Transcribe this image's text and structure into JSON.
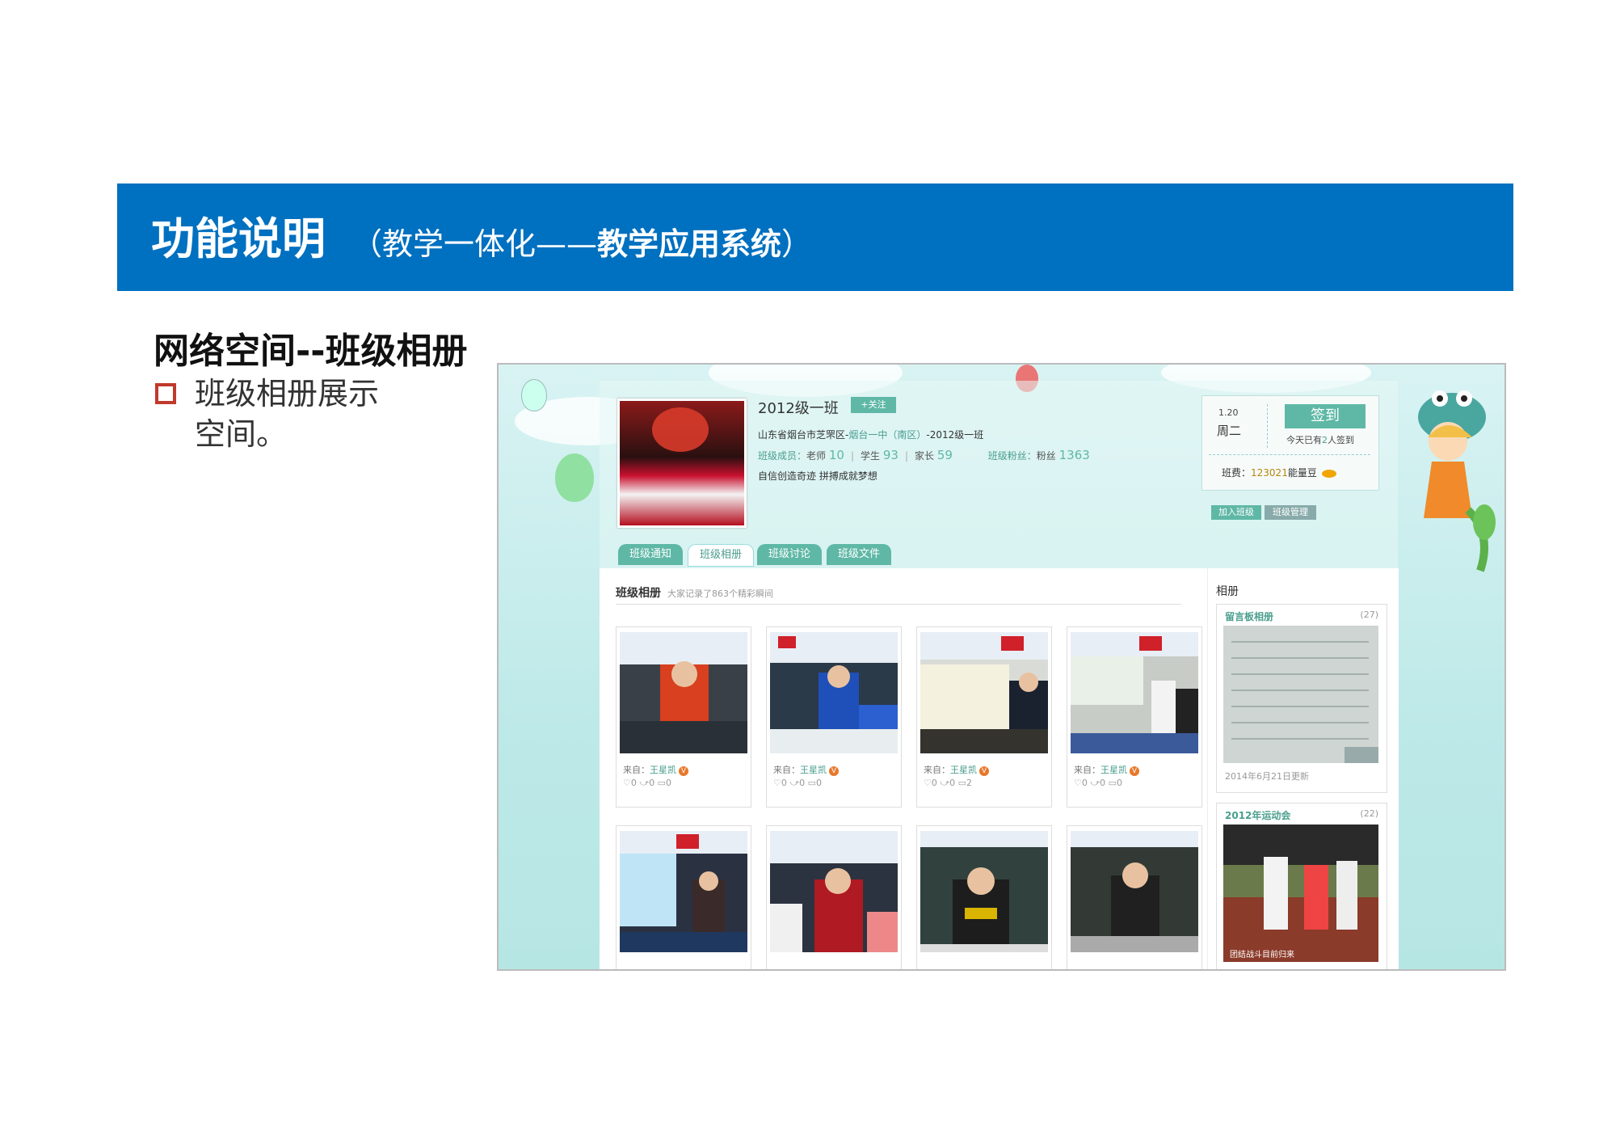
{
  "slide": {
    "header_title": "功能说明",
    "header_sub_open": "（教学一体化——",
    "header_sub_bold": "教学应用系统",
    "header_sub_close": "）",
    "section_title": "网络空间--班级相册",
    "bullet_line1": "班级相册展示",
    "bullet_line2": "空间。"
  },
  "class_page": {
    "class_name": "2012级一班",
    "follow_label": "+关注",
    "address_prefix": "山东省烟台市芝罘区-",
    "address_link": "烟台一中（南区）",
    "address_suffix": "-2012级一班",
    "members_label": "班级成员：",
    "teacher_label": "老师",
    "teacher_count": "10",
    "student_label": "学生",
    "student_count": "93",
    "parent_label": "家长",
    "parent_count": "59",
    "fans_label": "班级粉丝：",
    "fans_prefix": "粉丝",
    "fans_count": "1363",
    "motto": "自信创造奇迹   拼搏成就梦想",
    "sign": {
      "date": "1.20",
      "weekday": "周二",
      "button": "签到",
      "note_pre": "今天已有",
      "note_num": "2",
      "note_post": "人签到",
      "bean_label": "班费：",
      "bean_num": "123021",
      "bean_unit": "能量豆"
    },
    "join_button": "加入班级",
    "manage_button": "班级管理",
    "tabs": [
      "班级通知",
      "班级相册",
      "班级讨论",
      "班级文件"
    ],
    "album_header": "班级相册",
    "album_subheader": "大家记录了863个精彩瞬间",
    "photos": [
      {
        "from": "来自：",
        "user": "王星凯",
        "likes": "0",
        "shares": "0",
        "comments": "0"
      },
      {
        "from": "来自：",
        "user": "王星凯",
        "likes": "0",
        "shares": "0",
        "comments": "0"
      },
      {
        "from": "来自：",
        "user": "王星凯",
        "likes": "0",
        "shares": "0",
        "comments": "2"
      },
      {
        "from": "来自：",
        "user": "王星凯",
        "likes": "0",
        "shares": "0",
        "comments": "0"
      }
    ],
    "sidebar": {
      "title": "相册",
      "albums": [
        {
          "name": "留言板相册",
          "count": "(27)",
          "date": "2014年6月21日更新"
        },
        {
          "name": "2012年运动会",
          "count": "(22)",
          "caption": "团结战斗目前归来"
        }
      ]
    }
  },
  "colors": {
    "band": "#0070c0",
    "accent": "#5fb8a6",
    "bullet": "#c0392b"
  }
}
